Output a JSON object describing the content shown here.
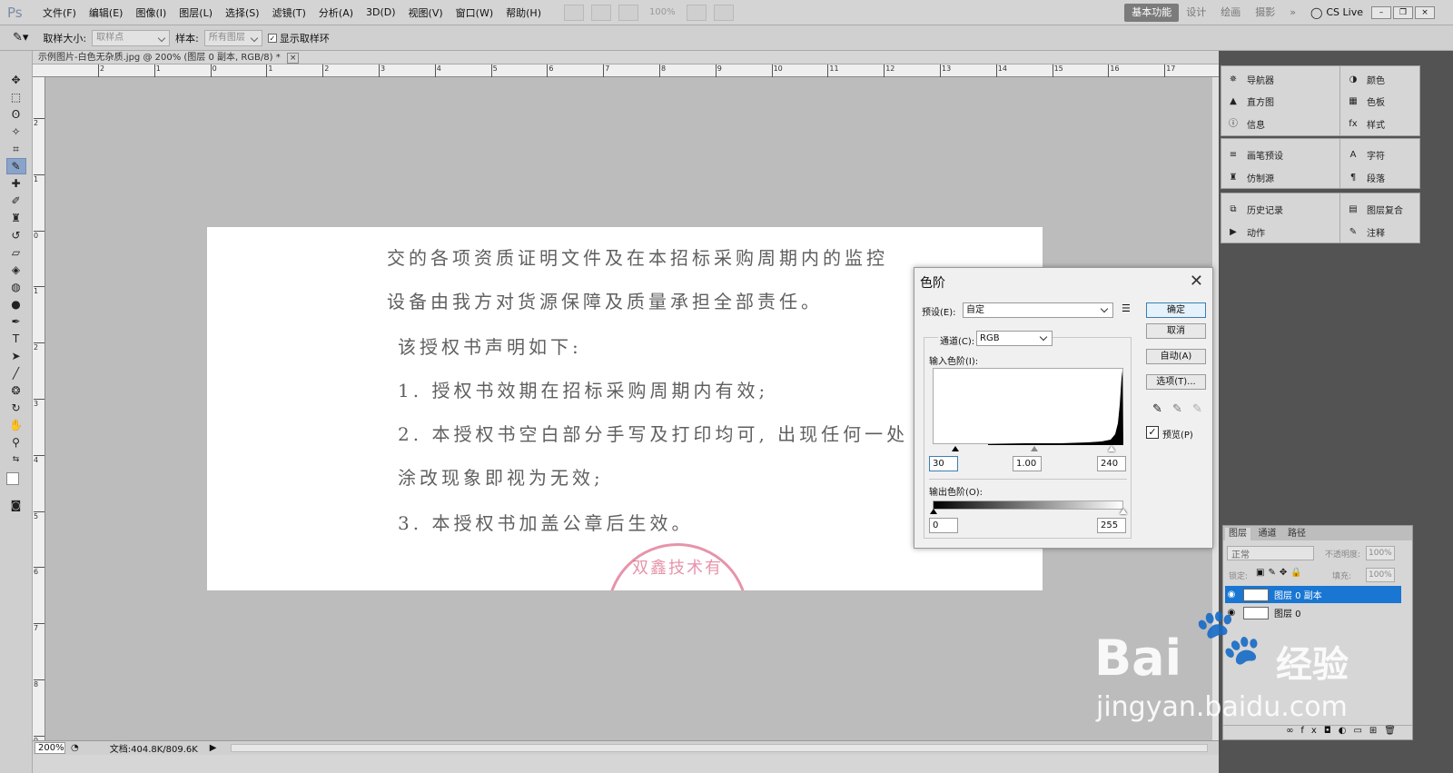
{
  "app": {
    "logo": "Ps"
  },
  "menu": [
    "文件(F)",
    "编辑(E)",
    "图像(I)",
    "图层(L)",
    "选择(S)",
    "滤镜(T)",
    "分析(A)",
    "3D(D)",
    "视图(V)",
    "窗口(W)",
    "帮助(H)"
  ],
  "menubar_right": {
    "zoom": "100%",
    "workspaces": [
      "基本功能",
      "设计",
      "绘画",
      "摄影"
    ],
    "cs_live": "CS Live"
  },
  "options": {
    "sample_size_label": "取样大小:",
    "sample_size_value": "取样点",
    "sample_label": "样本:",
    "sample_value": "所有图层",
    "show_ring_label": "显示取样环",
    "show_ring_checked": true
  },
  "doc_tab": {
    "title": "示例图片-白色无杂质.jpg @ 200% (图层 0 副本, RGB/8) *"
  },
  "ruler_h_ticks": [
    "2",
    "1",
    "0",
    "1",
    "2",
    "3",
    "4",
    "5",
    "6",
    "7",
    "8",
    "9",
    "10",
    "11",
    "12",
    "13",
    "14",
    "15",
    "16",
    "17"
  ],
  "ruler_v_ticks": [
    "2",
    "1",
    "0",
    "1",
    "2",
    "3",
    "4",
    "5",
    "6",
    "7",
    "8",
    "9"
  ],
  "document_lines": [
    "交的各项资质证明文件及在本招标采购周期内的监控",
    "设备由我方对货源保障及质量承担全部责任。",
    "该授权书声明如下:",
    "1. 授权书效期在招标采购周期内有效;",
    "2. 本授权书空白部分手写及打印均可, 出现任何一处",
    "涂改现象即视为无效;",
    "3. 本授权书加盖公章后生效。"
  ],
  "stamp_text": "双鑫技术有",
  "status": {
    "zoom": "200%",
    "doc_size": "文档:404.8K/809.6K"
  },
  "panels": {
    "group1_left": [
      "导航器",
      "直方图",
      "信息"
    ],
    "group1_right": [
      "颜色",
      "色板",
      "样式"
    ],
    "group2_left": [
      "画笔预设",
      "仿制源"
    ],
    "group2_right": [
      "字符",
      "段落"
    ],
    "group3_left": [
      "历史记录",
      "动作"
    ],
    "group3_right": [
      "图层复合",
      "注释"
    ]
  },
  "layers_panel": {
    "tabs": [
      "图层",
      "通道",
      "路径"
    ],
    "blend_mode": "正常",
    "opacity_label": "不透明度:",
    "opacity": "100%",
    "lock_label": "锁定:",
    "fill_label": "填充:",
    "fill": "100%",
    "layers": [
      {
        "name": "图层 0 副本",
        "selected": true
      },
      {
        "name": "图层 0",
        "selected": false
      }
    ]
  },
  "levels_dialog": {
    "title": "色阶",
    "preset_label": "预设(E):",
    "preset_value": "自定",
    "channel_label": "通道(C):",
    "channel_value": "RGB",
    "input_label": "输入色阶(I):",
    "input_black": "30",
    "input_gamma": "1.00",
    "input_white": "240",
    "output_label": "输出色阶(O):",
    "output_black": "0",
    "output_white": "255",
    "buttons": {
      "ok": "确定",
      "cancel": "取消",
      "auto": "自动(A)",
      "options": "选项(T)..."
    },
    "preview_label": "预览(P)",
    "preview_checked": true
  },
  "watermark": {
    "brand": "Bai",
    "brand2": "经验",
    "url": "jingyan.baidu.com"
  },
  "colors": {
    "accent": "#1976d2",
    "panel_dark": "#535353",
    "canvas_bg": "#bcbcbc"
  }
}
